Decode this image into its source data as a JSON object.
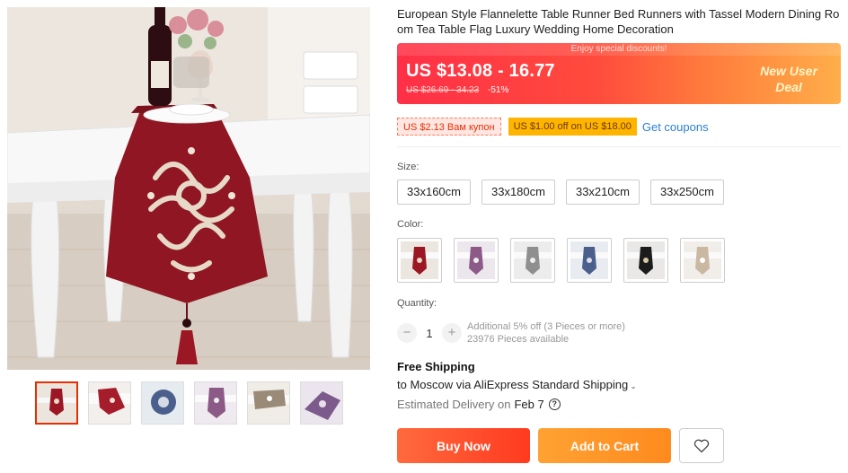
{
  "product": {
    "title": "European Style Flannelette Table Runner Bed Runners with Tassel Modern Dining Room Tea Table Flag Luxury Wedding Home Decoration"
  },
  "gallery": {
    "thumbnails": [
      "thumb-1",
      "thumb-2",
      "thumb-3",
      "thumb-4",
      "thumb-5",
      "thumb-6"
    ],
    "active_index": 0
  },
  "price": {
    "banner_top": "Enjoy special discounts!",
    "current": "US $13.08 - 16.77",
    "original": "US $26.69 - 34.23",
    "discount": "-51%",
    "promo_line1": "New User",
    "promo_line2": "Deal"
  },
  "coupons": {
    "coupon1": "US $2.13 Вам купон",
    "coupon2": "US $1.00 off on US $18.00",
    "get_link": "Get coupons"
  },
  "size": {
    "label": "Size:",
    "options": [
      "33x160cm",
      "33x180cm",
      "33x210cm",
      "33x250cm"
    ]
  },
  "color": {
    "label": "Color:",
    "options": [
      "red",
      "purple",
      "gray",
      "blue",
      "black",
      "beige"
    ],
    "colors": [
      "#9b1724",
      "#8c5a86",
      "#8f8f8f",
      "#4a5f8c",
      "#1c1c1c",
      "#c9b8a2"
    ]
  },
  "quantity": {
    "label": "Quantity:",
    "value": "1",
    "minus": "−",
    "plus": "+",
    "additional": "Additional 5% off (3 Pieces or more)",
    "available": "23976 Pieces available"
  },
  "shipping": {
    "title": "Free Shipping",
    "destination": "to Moscow via AliExpress Standard Shipping",
    "estimated_label": "Estimated Delivery on",
    "estimated_date": "Feb 7",
    "help": "?"
  },
  "actions": {
    "buy_now": "Buy Now",
    "add_to_cart": "Add to Cart"
  }
}
